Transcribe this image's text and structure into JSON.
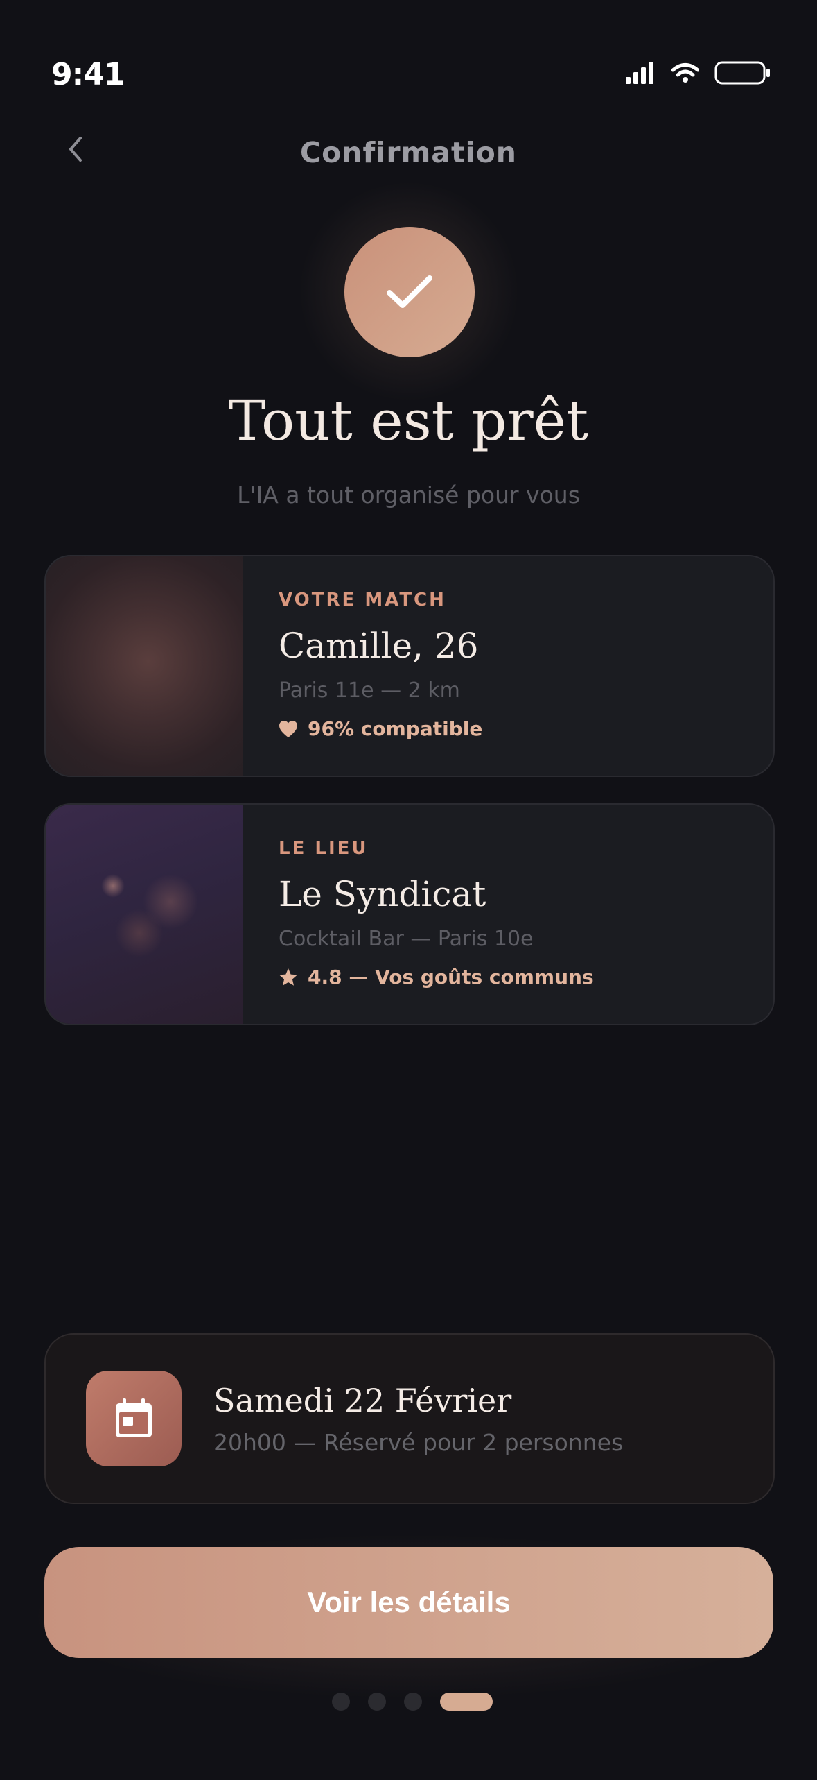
{
  "status_bar": {
    "time": "9:41"
  },
  "header": {
    "title": "Confirmation"
  },
  "hero": {
    "title": "Tout est prêt",
    "subtitle": "L'IA a tout organisé pour vous"
  },
  "match_card": {
    "label": "VOTRE MATCH",
    "name": "Camille, 26",
    "location": "Paris 11e — 2 km",
    "meta": "96% compatible",
    "meta_icon": "heart-icon"
  },
  "venue_card": {
    "label": "LE LIEU",
    "name": "Le Syndicat",
    "location": "Cocktail Bar — Paris 10e",
    "meta": "4.8 — Vos goûts communs",
    "meta_icon": "star-icon"
  },
  "date_card": {
    "icon": "calendar-icon",
    "title": "Samedi 22 Février",
    "subtitle": "20h00 — Réservé pour 2 personnes"
  },
  "cta": {
    "label": "Voir les détails"
  },
  "pager": {
    "active_index": 3,
    "count": 4
  },
  "colors": {
    "background": "#111116",
    "accent": "#d6ab92",
    "accent_label": "#d9977e",
    "card": "#1b1c21"
  }
}
